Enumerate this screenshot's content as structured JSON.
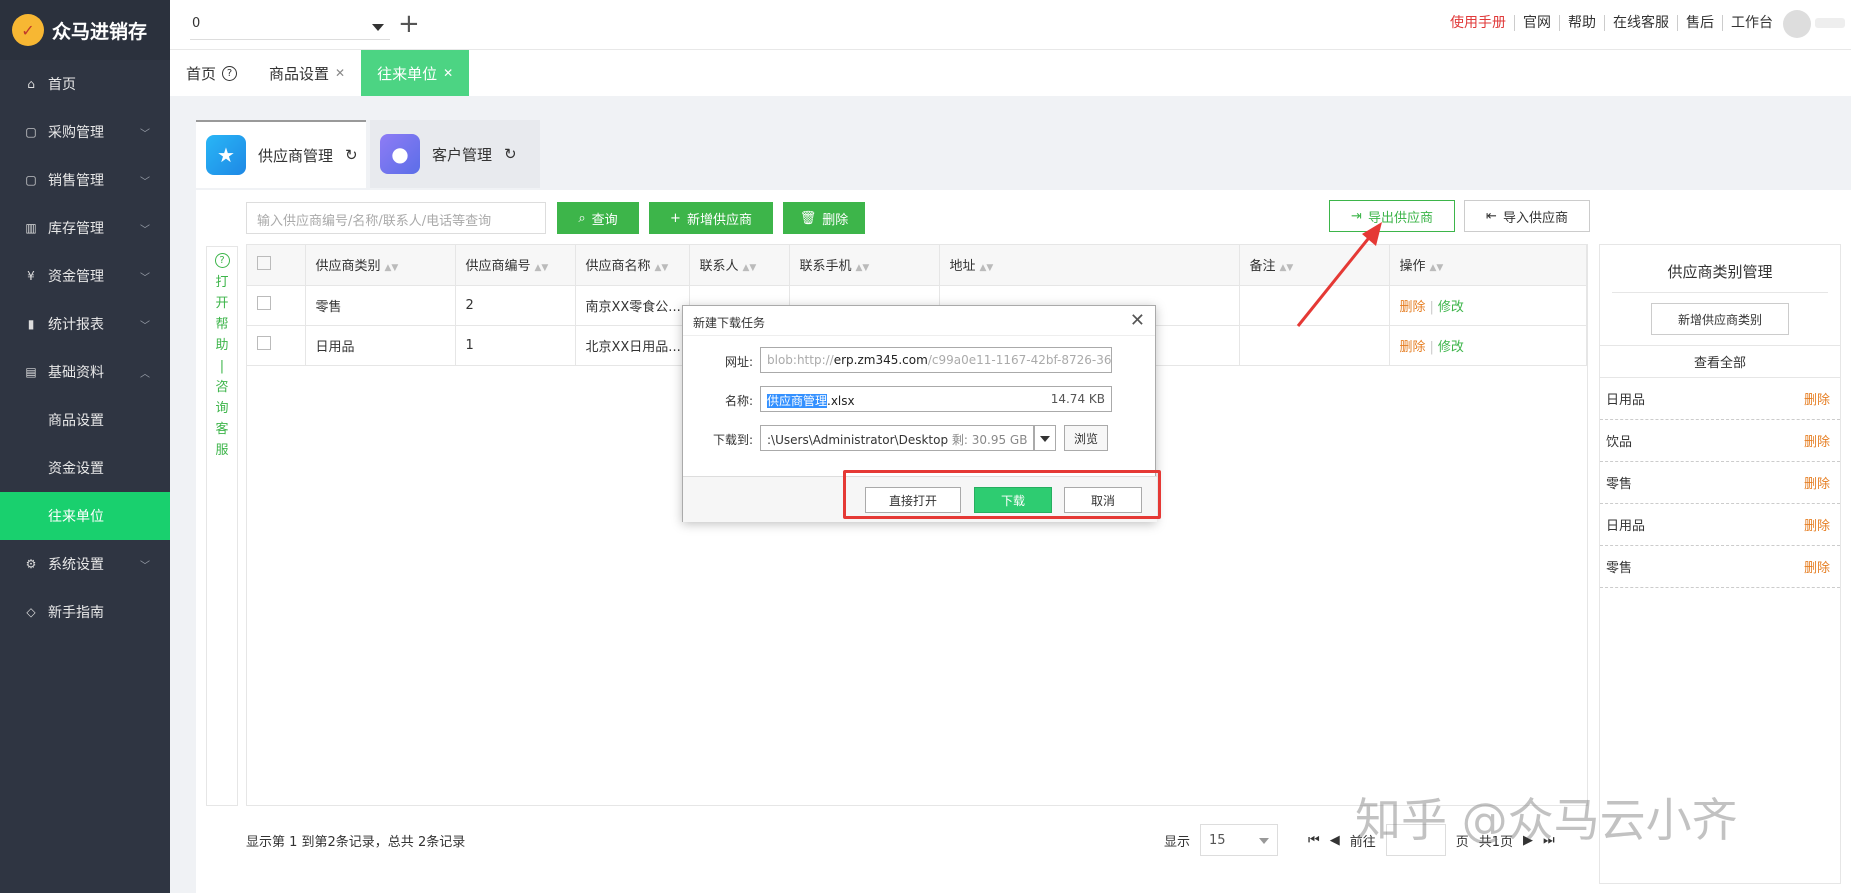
{
  "app": {
    "logo_text": "众马进销存"
  },
  "sidebar": {
    "items": [
      {
        "label": "首页",
        "icon": "home-icon",
        "chevron": ""
      },
      {
        "label": "采购管理",
        "icon": "bag-icon",
        "chevron": "down"
      },
      {
        "label": "销售管理",
        "icon": "bag-icon",
        "chevron": "down"
      },
      {
        "label": "库存管理",
        "icon": "warehouse-icon",
        "chevron": "down"
      },
      {
        "label": "资金管理",
        "icon": "money-icon",
        "chevron": "down"
      },
      {
        "label": "统计报表",
        "icon": "chart-icon",
        "chevron": "down"
      },
      {
        "label": "基础资料",
        "icon": "doc-icon",
        "chevron": "up"
      },
      {
        "label": "商品设置",
        "sub": true
      },
      {
        "label": "资金设置",
        "sub": true
      },
      {
        "label": "往来单位",
        "sub": true,
        "active": true
      },
      {
        "label": "系统设置",
        "icon": "gear-icon",
        "chevron": "down"
      },
      {
        "label": "新手指南",
        "icon": "tag-icon",
        "chevron": ""
      }
    ]
  },
  "topbar": {
    "store_value": "0",
    "links": [
      "使用手册",
      "官网",
      "帮助",
      "在线客服",
      "售后",
      "工作台"
    ]
  },
  "page_tabs": [
    {
      "label": "首页"
    },
    {
      "label": "商品设置"
    },
    {
      "label": "往来单位"
    }
  ],
  "module_tabs": [
    {
      "label": "供应商管理"
    },
    {
      "label": "客户管理"
    }
  ],
  "toolbar": {
    "search_placeholder": "输入供应商编号/名称/联系人/电话等查询",
    "query_label": "查询",
    "add_label": "新增供应商",
    "delete_label": "删除",
    "export_label": "导出供应商",
    "import_label": "导入供应商"
  },
  "help_column": {
    "chars": [
      "打",
      "开",
      "帮",
      "助",
      "|",
      "咨",
      "询",
      "客",
      "服"
    ]
  },
  "table": {
    "headers": [
      "供应商类别",
      "供应商编号",
      "供应商名称",
      "联系人",
      "联系手机",
      "地址",
      "备注",
      "操作"
    ],
    "rows": [
      {
        "category": "零售",
        "code": "2",
        "name": "南京XX零食公...",
        "contact": "",
        "phone": "",
        "address": "",
        "remark": ""
      },
      {
        "category": "日用品",
        "code": "1",
        "name": "北京XX日用品...",
        "contact": "",
        "phone": "",
        "address": "",
        "remark": ""
      }
    ],
    "op_delete": "删除",
    "op_edit": "修改"
  },
  "footer": {
    "info": "显示第 1 到第2条记录，总共 2条记录",
    "show_label": "显示",
    "page_size": "15",
    "goto_label": "前往",
    "page_unit": "页",
    "total_pages": "共1页"
  },
  "category_panel": {
    "title": "供应商类别管理",
    "add_label": "新增供应商类别",
    "view_all": "查看全部",
    "items": [
      "日用品",
      "饮品",
      "零售",
      "日用品",
      "零售"
    ],
    "delete_label": "删除"
  },
  "dialog": {
    "title": "新建下载任务",
    "url_label": "网址:",
    "url_prefix": "blob:http://",
    "url_host": "erp.zm345.com",
    "url_rest": "/c99a0e11-1167-42bf-8726-364",
    "name_label": "名称:",
    "name_base": "供应商管理",
    "name_ext": ".xlsx",
    "file_size": "14.74 KB",
    "saveto_label": "下载到:",
    "path": ":\\Users\\Administrator\\Desktop",
    "free_space": "剩: 30.95 GB",
    "browse_label": "浏览",
    "open_label": "直接打开",
    "download_label": "下载",
    "cancel_label": "取消"
  },
  "watermark": "知乎 @众马云小齐",
  "colors": {
    "sidebar_bg": "#2f3542",
    "accent_green": "#3db54a",
    "active_green": "#19d06e",
    "highlight_red": "#e53935",
    "delete_orange": "#e67e22"
  }
}
